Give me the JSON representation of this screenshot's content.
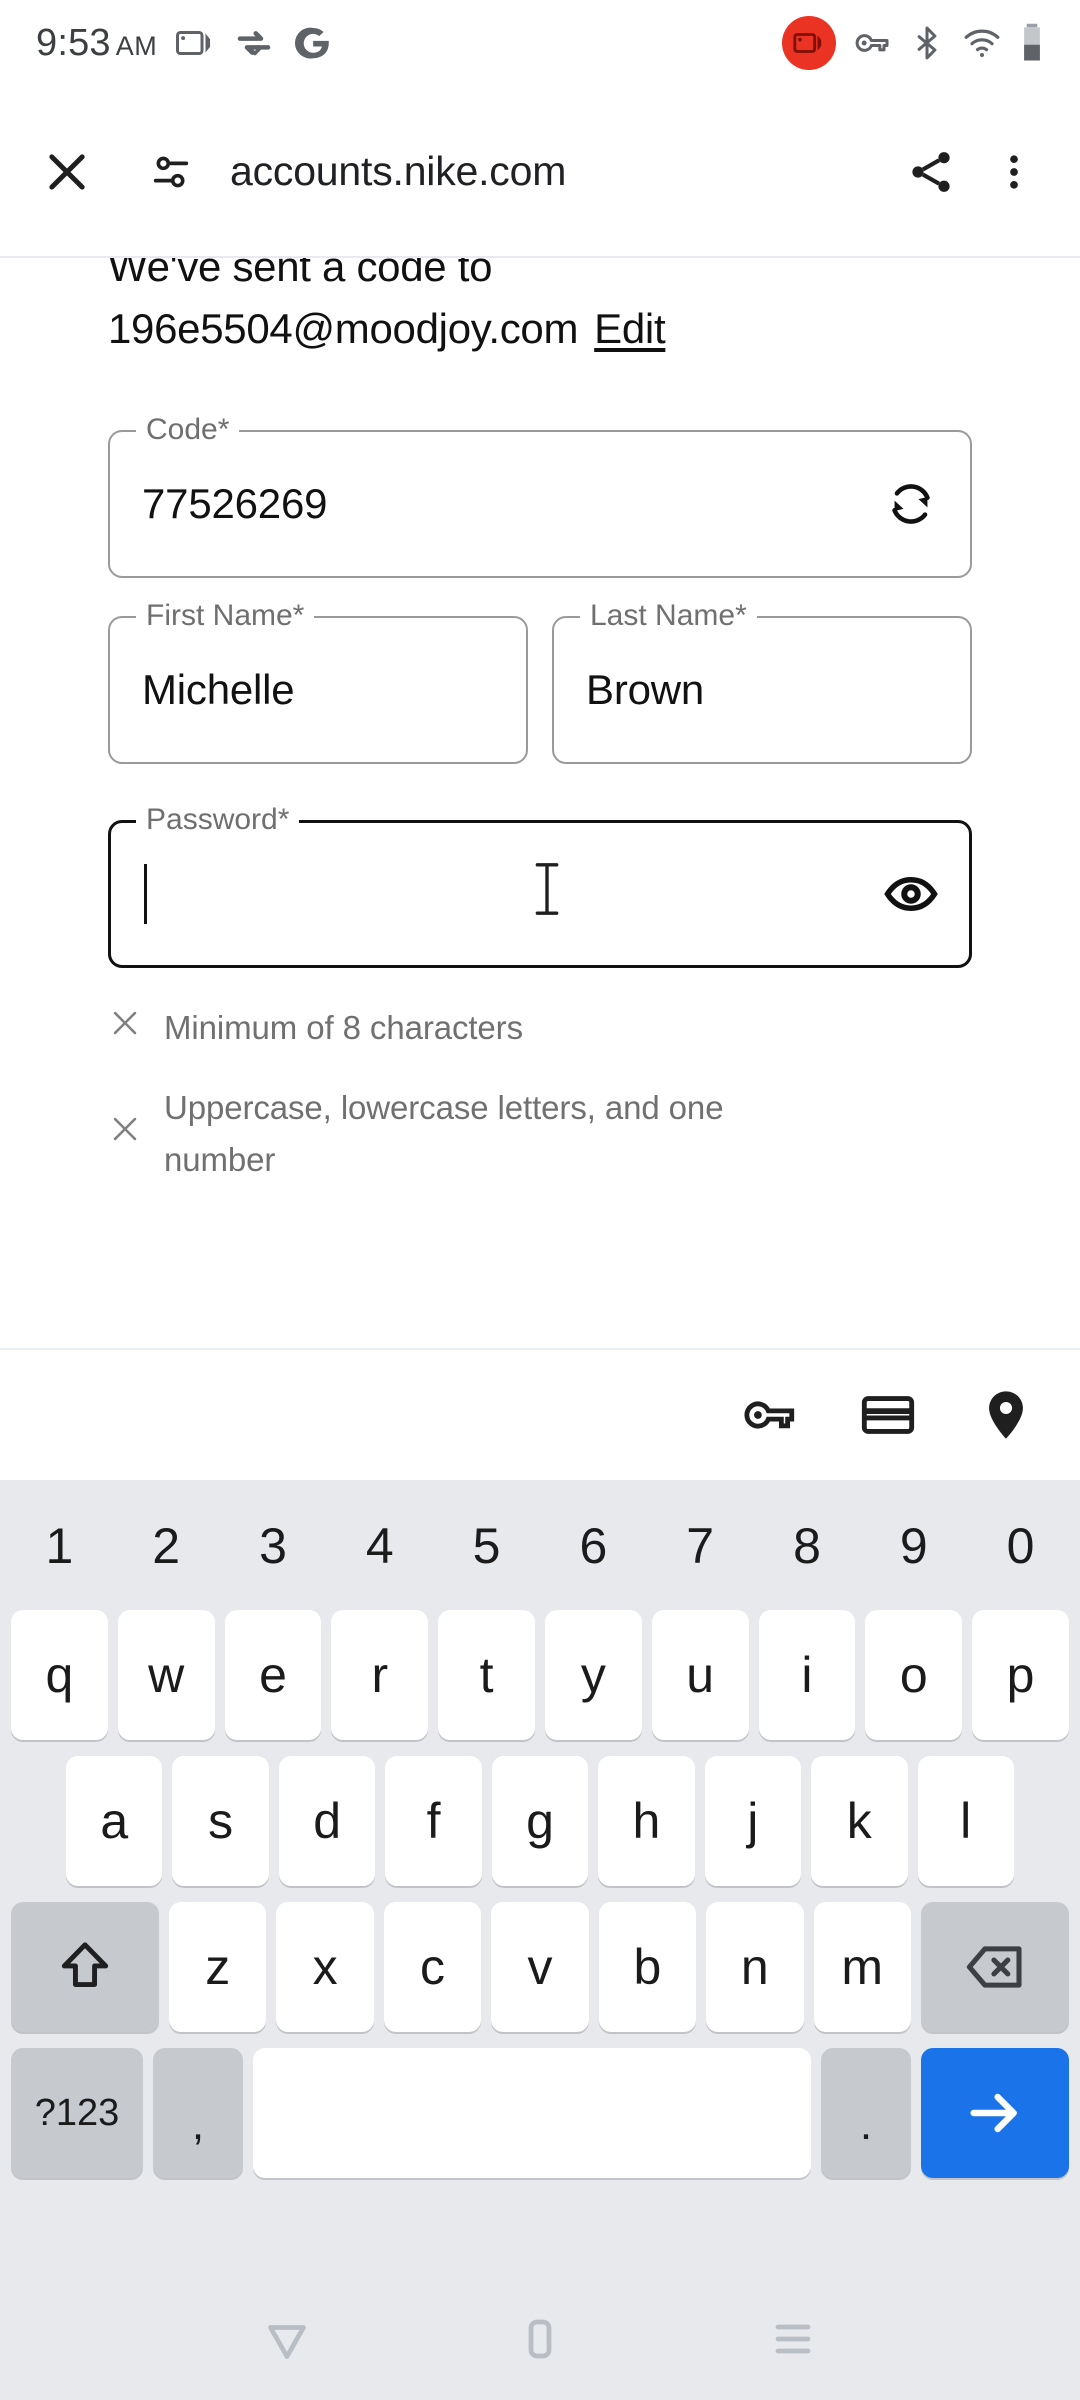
{
  "status_bar": {
    "time": "9:53",
    "ampm": "AM",
    "left_icons": [
      "screen-cast-icon",
      "sync-check-icon",
      "google-g-icon"
    ],
    "right_icons": [
      "screen-recording-badge-icon",
      "vpn-key-icon",
      "bluetooth-icon",
      "wifi-icon",
      "battery-icon"
    ],
    "recording_badge_color": "#ea3323"
  },
  "browser": {
    "close_label": "close-tab",
    "site_settings_label": "site-settings",
    "url": "accounts.nike.com",
    "share_label": "share",
    "menu_label": "more-options"
  },
  "page": {
    "sent_line1": "We've sent a code to",
    "email": "196e5504@moodjoy.com",
    "edit_label": "Edit",
    "fields": {
      "code": {
        "label": "Code*",
        "value": "77526269",
        "icon": "refresh-icon"
      },
      "first_name": {
        "label": "First Name*",
        "value": "Michelle"
      },
      "last_name": {
        "label": "Last Name*",
        "value": "Brown"
      },
      "password": {
        "label": "Password*",
        "value": "",
        "icon": "eye-icon"
      }
    },
    "password_hints": [
      {
        "marker": "x",
        "text": "Minimum of 8 characters"
      },
      {
        "marker": "x",
        "text": "Uppercase, lowercase letters, and one number"
      }
    ]
  },
  "keyboard": {
    "suggestion_icons": [
      "vpn-key-icon",
      "credit-card-icon",
      "location-pin-icon"
    ],
    "number_row": [
      "1",
      "2",
      "3",
      "4",
      "5",
      "6",
      "7",
      "8",
      "9",
      "0"
    ],
    "row_qwerty": [
      "q",
      "w",
      "e",
      "r",
      "t",
      "y",
      "u",
      "i",
      "o",
      "p"
    ],
    "row_asdf": [
      "a",
      "s",
      "d",
      "f",
      "g",
      "h",
      "j",
      "k",
      "l"
    ],
    "row_zxcv": [
      "z",
      "x",
      "c",
      "v",
      "b",
      "n",
      "m"
    ],
    "shift_label": "shift-icon",
    "backspace_label": "backspace-icon",
    "symbols_label": "?123",
    "comma_label": ",",
    "space_label": "",
    "period_label": ".",
    "enter_label": "arrow-right-icon",
    "enter_color": "#1a73e8",
    "background_color": "#e7e9ed",
    "key_color": "#ffffff",
    "mod_key_color": "#c6c9ce"
  },
  "navbar": {
    "back_label": "back-icon",
    "home_label": "home-icon",
    "recents_label": "recents-icon"
  }
}
